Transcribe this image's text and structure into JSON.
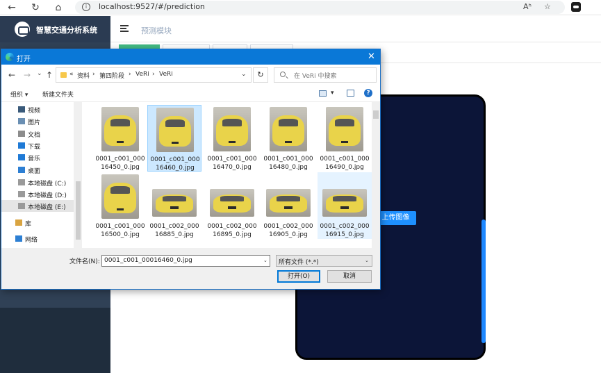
{
  "browser": {
    "url": "localhost:9527/#/prediction",
    "back_glyph": "←",
    "refresh_glyph": "↻",
    "home_glyph": "⌂",
    "info_glyph": "i",
    "read_aloud_glyph": "Aʰ",
    "favorite_glyph": "☆",
    "icons": [
      "back-icon",
      "refresh-icon",
      "home-icon",
      "info-icon",
      "read-aloud-icon",
      "favorite-icon",
      "extension-icon"
    ]
  },
  "app": {
    "title": "智慧交通分析系统",
    "breadcrumb": "预测模块",
    "upload_button": "上传图像",
    "colors": {
      "sidebar": "#304156",
      "accent": "#1e90ff",
      "tab_active": "#42b983",
      "device": "#0c1538"
    }
  },
  "dialog": {
    "title": "打开",
    "close_glyph": "✕",
    "nav_back": "←",
    "nav_forward": "→",
    "nav_recent": "⌄",
    "nav_up": "↑",
    "path_prefix": "«",
    "path": [
      "资料",
      "第四阶段",
      "VeRi",
      "VeRi"
    ],
    "path_sep": "›",
    "path_dropdown": "⌄",
    "refresh": "↻",
    "search_placeholder": "在 VeRi 中搜索",
    "toolbar": {
      "organize": "组织 ▾",
      "new_folder": "新建文件夹",
      "view_dropdown": "▾",
      "help": "?"
    },
    "nav_items": [
      {
        "label": "视频",
        "icon": "video-icon"
      },
      {
        "label": "图片",
        "icon": "pictures-icon"
      },
      {
        "label": "文档",
        "icon": "documents-icon"
      },
      {
        "label": "下载",
        "icon": "download-icon"
      },
      {
        "label": "音乐",
        "icon": "music-icon"
      },
      {
        "label": "桌面",
        "icon": "desktop-icon"
      },
      {
        "label": "本地磁盘 (C:)",
        "icon": "drive-icon"
      },
      {
        "label": "本地磁盘 (D:)",
        "icon": "drive-icon"
      },
      {
        "label": "本地磁盘 (E:)",
        "icon": "drive-icon",
        "selected": true
      },
      {
        "label": "库",
        "icon": "library-icon"
      },
      {
        "label": "网络",
        "icon": "network-icon"
      }
    ],
    "files": [
      {
        "line1": "0001_c001_000",
        "line2": "16450_0.jpg"
      },
      {
        "line1": "0001_c001_000",
        "line2": "16460_0.jpg",
        "state": "selected"
      },
      {
        "line1": "0001_c001_000",
        "line2": "16470_0.jpg"
      },
      {
        "line1": "0001_c001_000",
        "line2": "16480_0.jpg"
      },
      {
        "line1": "0001_c001_000",
        "line2": "16490_0.jpg"
      },
      {
        "line1": "0001_c001_000",
        "line2": "16500_0.jpg"
      },
      {
        "line1": "0001_c002_000",
        "line2": "16885_0.jpg"
      },
      {
        "line1": "0001_c002_000",
        "line2": "16895_0.jpg"
      },
      {
        "line1": "0001_c002_000",
        "line2": "16905_0.jpg"
      },
      {
        "line1": "0001_c002_000",
        "line2": "16915_0.jpg",
        "state": "hover"
      }
    ],
    "filename_label": "文件名(N):",
    "filename_value": "0001_c001_00016460_0.jpg",
    "filetype_value": "所有文件 (*.*)",
    "dropdown_glyph": "⌄",
    "open_button": "打开(O)",
    "cancel_button": "取消"
  }
}
